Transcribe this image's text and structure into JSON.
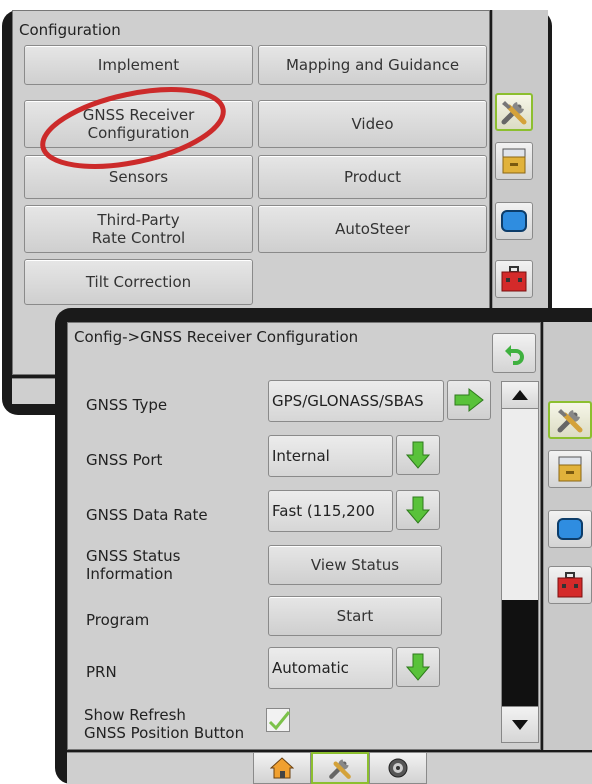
{
  "config_screen": {
    "title": "Configuration",
    "buttons": {
      "implement": "Implement",
      "mapping_guidance": "Mapping and Guidance",
      "gnss_line1": "GNSS Receiver",
      "gnss_line2": "Configuration",
      "video": "Video",
      "sensors": "Sensors",
      "product": "Product",
      "third_party_line1": "Third-Party",
      "third_party_line2": "Rate Control",
      "autosteer": "AutoSteer",
      "tilt_correction": "Tilt Correction"
    },
    "annotation_color": "#cc2a2a"
  },
  "gnss_screen": {
    "title": "Config->GNSS Receiver Configuration",
    "rows": {
      "gnss_type": {
        "label": "GNSS Type",
        "value": "GPS/GLONASS/SBAS"
      },
      "gnss_port": {
        "label": "GNSS Port",
        "value": "Internal"
      },
      "data_rate": {
        "label": "GNSS Data Rate",
        "value": "Fast (115,200"
      },
      "status": {
        "label_line1": "GNSS Status",
        "label_line2": "Information",
        "button": "View Status"
      },
      "program": {
        "label": "Program",
        "button": "Start"
      },
      "prn": {
        "label": "PRN",
        "value": "Automatic"
      },
      "refresh": {
        "label_line1": "Show Refresh",
        "label_line2": "GNSS Position Button",
        "checked": true
      }
    }
  },
  "sidebar_icons": [
    "tools-icon",
    "console-icon",
    "screen-icon",
    "toolbox-icon"
  ],
  "bottom_tabs": [
    "home-icon",
    "tools-icon",
    "camera-icon"
  ],
  "colors": {
    "accent_green": "#8cbf2f",
    "bezel": "#1a1a1a",
    "panel": "#cfcfcf"
  }
}
